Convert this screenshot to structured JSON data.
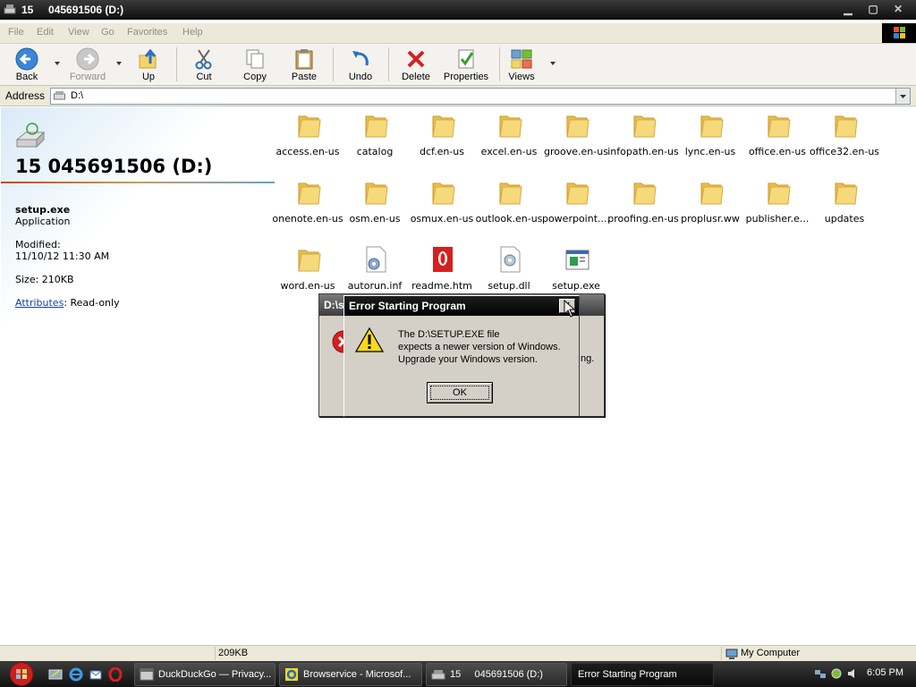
{
  "window": {
    "title": "15     045691506 (D:)"
  },
  "menu": {
    "items": [
      "File",
      "Edit",
      "View",
      "Go",
      "Favorites",
      "Help"
    ]
  },
  "toolbar": {
    "back": "Back",
    "forward": "Forward",
    "up": "Up",
    "cut": "Cut",
    "copy": "Copy",
    "paste": "Paste",
    "undo": "Undo",
    "delete": "Delete",
    "properties": "Properties",
    "views": "Views"
  },
  "address": {
    "label": "Address",
    "value": "D:\\"
  },
  "details": {
    "drive_title": "15 045691506 (D:)",
    "file_name": "setup.exe",
    "file_type": "Application",
    "modified_label": "Modified:",
    "modified_value": "11/10/12 11:30 AM",
    "size_text": "Size: 210KB",
    "attributes_link": "Attributes",
    "attributes_value": ": Read-only"
  },
  "files": [
    {
      "name": "access.en-us",
      "icon": "folder-icon"
    },
    {
      "name": "catalog",
      "icon": "folder-icon"
    },
    {
      "name": "dcf.en-us",
      "icon": "folder-icon"
    },
    {
      "name": "excel.en-us",
      "icon": "folder-icon"
    },
    {
      "name": "groove.en-us",
      "icon": "folder-icon"
    },
    {
      "name": "infopath.en-us",
      "icon": "folder-icon"
    },
    {
      "name": "lync.en-us",
      "icon": "folder-icon"
    },
    {
      "name": "office.en-us",
      "icon": "folder-icon"
    },
    {
      "name": "office32.en-us",
      "icon": "folder-icon"
    },
    {
      "name": "onenote.en-us",
      "icon": "folder-icon"
    },
    {
      "name": "osm.en-us",
      "icon": "folder-icon"
    },
    {
      "name": "osmux.en-us",
      "icon": "folder-icon"
    },
    {
      "name": "outlook.en-us",
      "icon": "folder-icon"
    },
    {
      "name": "powerpoint....",
      "icon": "folder-icon"
    },
    {
      "name": "proofing.en-us",
      "icon": "folder-icon"
    },
    {
      "name": "proplusr.ww",
      "icon": "folder-icon"
    },
    {
      "name": "publisher.e...",
      "icon": "folder-icon"
    },
    {
      "name": "updates",
      "icon": "folder-icon"
    },
    {
      "name": "word.en-us",
      "icon": "folder-icon"
    },
    {
      "name": "autorun.inf",
      "icon": "settings-file-icon"
    },
    {
      "name": "readme.htm",
      "icon": "opera-html-icon"
    },
    {
      "name": "setup.dll",
      "icon": "dll-file-icon"
    },
    {
      "name": "setup.exe",
      "icon": "exe-file-icon"
    }
  ],
  "dialog_back": {
    "title": "D:\\s",
    "text_fragment": "ng."
  },
  "dialog": {
    "title": "Error Starting Program",
    "close": "×",
    "line1": "The D:\\SETUP.EXE file",
    "line2": "expects a newer version of Windows.",
    "line3": "Upgrade your Windows version.",
    "ok": "OK"
  },
  "status": {
    "size": "209KB",
    "location": "My Computer"
  },
  "taskbar": {
    "items": [
      {
        "label": "DuckDuckGo — Privacy..."
      },
      {
        "label": "Browservice - Microsof..."
      },
      {
        "label": "15     045691506 (D:)"
      },
      {
        "label": "Error Starting Program"
      }
    ],
    "clock": "6:05 PM"
  },
  "colors": {
    "title_bar": "#1a1a1a",
    "dialog_face": "#d4d0c8",
    "folder_yellow": "#f3d36b",
    "link_blue": "#1a3fa0"
  }
}
